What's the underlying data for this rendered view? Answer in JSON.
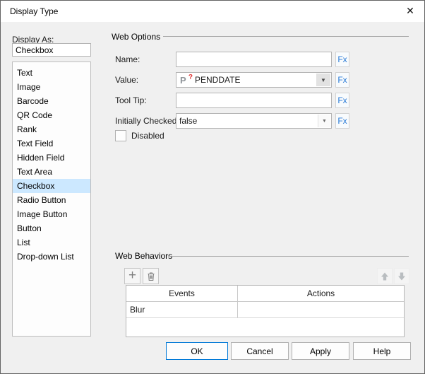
{
  "dialog": {
    "title": "Display Type",
    "close_icon": "✕"
  },
  "display_as": {
    "label": "Display As:",
    "value": "Checkbox",
    "selected_index": 8,
    "options": [
      "Text",
      "Image",
      "Barcode",
      "QR Code",
      "Rank",
      "Text Field",
      "Hidden Field",
      "Text Area",
      "Checkbox",
      "Radio Button",
      "Image Button",
      "Button",
      "List",
      "Drop-down List"
    ]
  },
  "web_options": {
    "title": "Web Options",
    "fx_label": "Fx",
    "fields": {
      "name": {
        "label": "Name:",
        "value": ""
      },
      "value": {
        "label": "Value:",
        "value": "PENDDATE",
        "icon": "parameter-icon",
        "icon_letter": "P",
        "icon_mark": "?"
      },
      "tooltip": {
        "label": "Tool Tip:",
        "value": ""
      },
      "initially_checked": {
        "label": "Initially Checked:",
        "value": "false"
      }
    },
    "disabled_checkbox": {
      "label": "Disabled",
      "checked": false
    },
    "dropdown_arrow": "▼"
  },
  "web_behaviors": {
    "title": "Web Behaviors",
    "toolbar": {
      "add_icon": "+",
      "delete_icon": "trash-icon",
      "up_icon": "up-arrow",
      "down_icon": "down-arrow"
    },
    "table": {
      "headers": {
        "events": "Events",
        "actions": "Actions"
      },
      "rows": [
        {
          "event": "Blur",
          "action": ""
        }
      ]
    }
  },
  "footer": {
    "ok": "OK",
    "cancel": "Cancel",
    "apply": "Apply",
    "help": "Help"
  },
  "colors": {
    "dialog_bg": "#f0f0f0",
    "titlebar_bg": "#ffffff",
    "selection_bg": "#cce8ff",
    "fx_blue": "#2b7bd6",
    "ok_border_blue": "#0078d7",
    "param_icon_gray": "#8f9499",
    "param_mark_red": "#e03232"
  }
}
